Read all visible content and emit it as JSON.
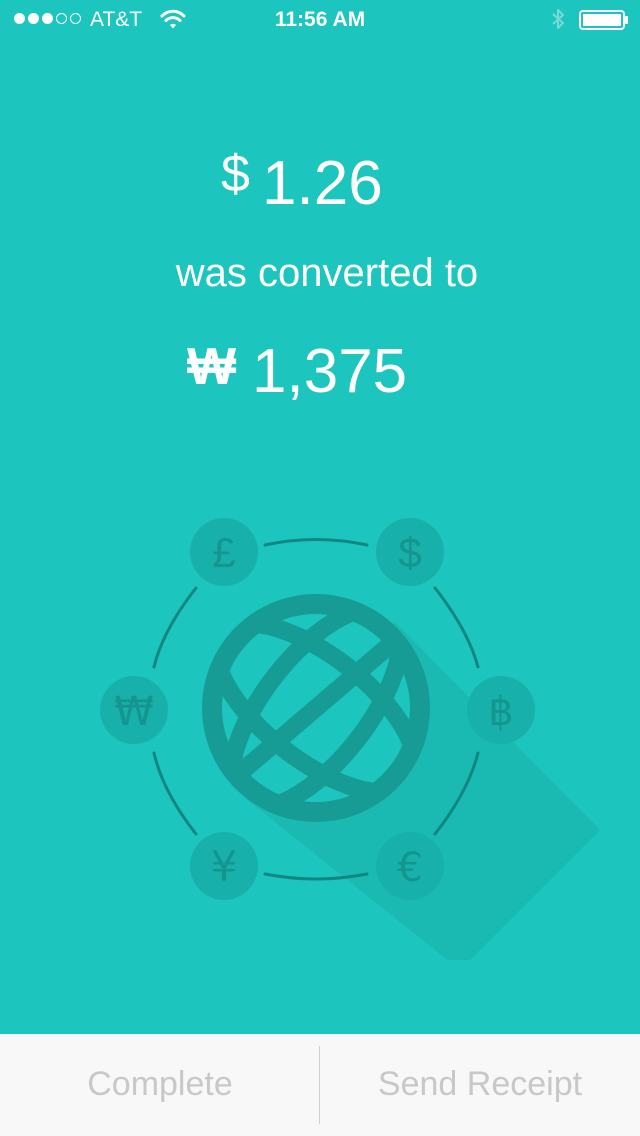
{
  "status_bar": {
    "carrier": "AT&T",
    "time": "11:56 AM",
    "signal_bars_filled": 3,
    "signal_bars_total": 5
  },
  "conversion": {
    "from_symbol": "$",
    "from_amount": "1.26",
    "connector_text": "was converted to",
    "to_symbol": "₩",
    "to_amount": "1,375"
  },
  "illustration": {
    "currency_symbols": [
      "£",
      "$",
      "฿",
      "€",
      "¥",
      "₩"
    ],
    "center_icon": "globe-icon"
  },
  "actions": {
    "complete_label": "Complete",
    "send_receipt_label": "Send Receipt"
  },
  "colors": {
    "background": "#1dc5bf",
    "accent_dark": "#179c95",
    "bottom_bar": "#f8f8f8",
    "button_text": "#c8c8c8"
  }
}
